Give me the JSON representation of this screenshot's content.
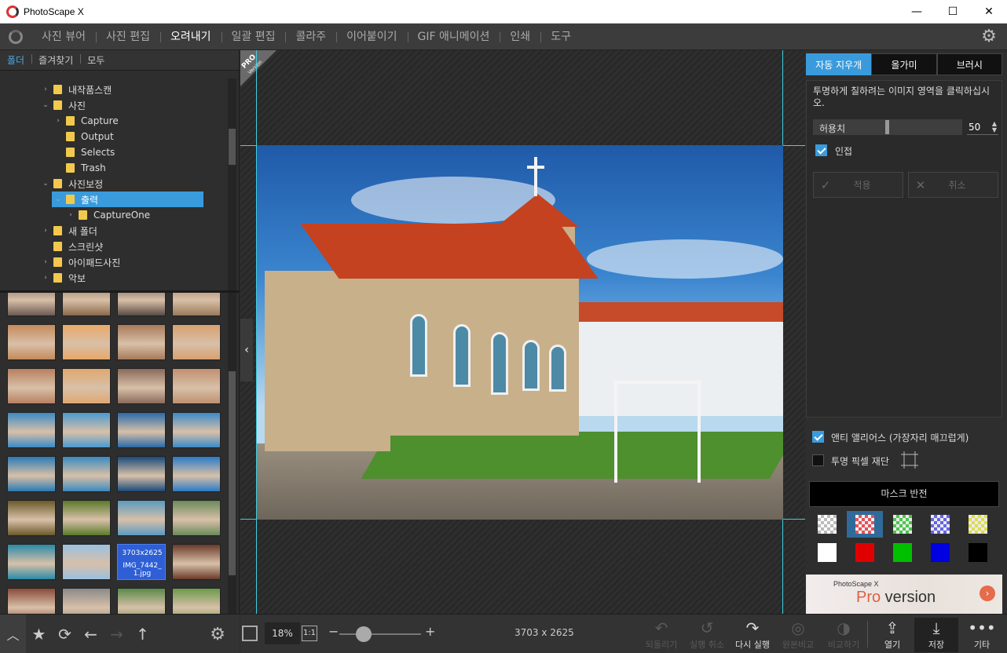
{
  "window": {
    "title": "PhotoScape X",
    "minimize": "—",
    "maximize": "☐",
    "close": "✕"
  },
  "menu": {
    "items": [
      "사진 뷰어",
      "사진 편집",
      "오려내기",
      "일괄 편집",
      "콜라주",
      "이어붙이기",
      "GIF 애니메이션",
      "인쇄",
      "도구"
    ],
    "active_index": 2,
    "settings_icon": "gear-icon"
  },
  "left_tabs": [
    "폴더",
    "즐겨찾기",
    "모두"
  ],
  "tree": [
    {
      "label": "내작품스캔",
      "depth": 0,
      "expandable": true,
      "selected": false
    },
    {
      "label": "사진",
      "depth": 0,
      "expandable": true,
      "selected": false
    },
    {
      "label": "Capture",
      "depth": 1,
      "expandable": true,
      "selected": false
    },
    {
      "label": "Output",
      "depth": 1,
      "expandable": false,
      "selected": false
    },
    {
      "label": "Selects",
      "depth": 1,
      "expandable": false,
      "selected": false
    },
    {
      "label": "Trash",
      "depth": 1,
      "expandable": false,
      "selected": false
    },
    {
      "label": "사진보정",
      "depth": 0,
      "expandable": true,
      "selected": false
    },
    {
      "label": "출력",
      "depth": 1,
      "expandable": true,
      "selected": true
    },
    {
      "label": "CaptureOne",
      "depth": 2,
      "expandable": true,
      "selected": false
    },
    {
      "label": "새 폴더",
      "depth": 0,
      "expandable": true,
      "selected": false
    },
    {
      "label": "스크린샷",
      "depth": 0,
      "expandable": false,
      "selected": false
    },
    {
      "label": "아이패드사진",
      "depth": 0,
      "expandable": true,
      "selected": false
    },
    {
      "label": "악보",
      "depth": 0,
      "expandable": true,
      "selected": false
    }
  ],
  "thumbnails": {
    "colors": [
      [
        "#6b5a52",
        "#8a6a4a",
        "#5a4a44",
        "#9a7a5a"
      ],
      [
        "#c48a5a",
        "#e8a868",
        "#a87a5a",
        "#d8a070"
      ],
      [
        "#b88060",
        "#e0a870",
        "#8a6a5a",
        "#c09070"
      ],
      [
        "#3a8ac4",
        "#4a9ad0",
        "#2a6aa8",
        "#3a8ac8"
      ],
      [
        "#2a7ab4",
        "#3a8ac0",
        "#1a4a7a",
        "#2a7ac8"
      ],
      [
        "#6a5a2a",
        "#5a7a2a",
        "#5a9ac0",
        "#6a8a5a"
      ],
      [
        "#2a8aa8",
        "#9ac0e0",
        "#2e5fd6",
        "#6a3a2a"
      ],
      [
        "#8a4a3a",
        "#8a8a8a",
        "#5a8a4a",
        "#6a9a4a"
      ],
      [
        "#6a7a6a",
        "#a0a8a0",
        "#5a7a3a",
        "#3a6a2a"
      ]
    ],
    "selected": {
      "row": 6,
      "col": 2,
      "dims": "3703x2625",
      "name_line1": "IMG_7442_",
      "name_line2": "1.jpg"
    }
  },
  "left_bottom": {
    "collapse_icon": "chevron-up-icon",
    "favorite_icon": "star-icon",
    "refresh_icon": "refresh-icon",
    "back_icon": "arrow-left-icon",
    "forward_icon": "arrow-right-icon",
    "up_icon": "arrow-up-icon",
    "settings_icon": "gear-icon"
  },
  "canvas": {
    "pro_badge_line1": "PRO",
    "pro_badge_line2": "Version"
  },
  "right": {
    "tabs": [
      "자동 지우개",
      "올가미",
      "브러시"
    ],
    "active_tab": 0,
    "description": "투명하게 칠하려는 이미지 영역을 클릭하십시오.",
    "tolerance_label": "허용치",
    "tolerance_value": "50",
    "tolerance_fraction": 0.5,
    "adjacent_label": "인접",
    "adjacent_checked": true,
    "apply_label": "적용",
    "cancel_label": "취소",
    "antialias_label": "앤티 앨리어스 (가장자리 매끄럽게)",
    "antialias_checked": true,
    "trim_label": "투명 픽셀 재단",
    "trim_checked": false,
    "invert_mask_label": "마스크 반전",
    "mask_colors": [
      [
        "checker",
        "#ff4d4d",
        "#4dd84d",
        "#6a6aff",
        "#f0f04d"
      ],
      [
        "#ffffff",
        "#e00000",
        "#00c000",
        "#0000e0",
        "#000000"
      ]
    ],
    "mask_selected": {
      "row": 0,
      "col": 1
    },
    "ad_brand": "PhotoScape X",
    "ad_pro": "Pro",
    "ad_version": " version"
  },
  "bottom": {
    "zoom": "18%",
    "one_to_one": "1:1",
    "zoom_fraction": 0.3,
    "image_dims": "3703 x 2625",
    "tools": [
      {
        "label": "되돌리기",
        "icon": "undo-icon",
        "glyph": "↶",
        "disabled": true
      },
      {
        "label": "실행 취소",
        "icon": "undo-all-icon",
        "glyph": "↺",
        "disabled": true
      },
      {
        "label": "다시 실행",
        "icon": "redo-icon",
        "glyph": "↷",
        "disabled": false
      },
      {
        "label": "원본비교",
        "icon": "compare-icon",
        "glyph": "◎",
        "disabled": true
      },
      {
        "label": "비교하기",
        "icon": "compare-half-icon",
        "glyph": "◑",
        "disabled": true
      },
      {
        "label": "열기",
        "icon": "open-icon",
        "glyph": "⇪",
        "disabled": false
      },
      {
        "label": "저장",
        "icon": "save-icon",
        "glyph": "⤓",
        "disabled": false
      },
      {
        "label": "기타",
        "icon": "more-icon",
        "glyph": "•••",
        "disabled": false
      }
    ]
  }
}
